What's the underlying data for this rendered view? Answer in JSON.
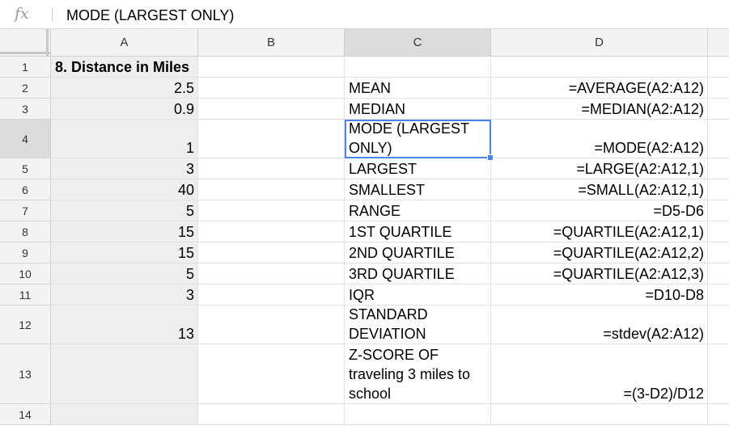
{
  "formula_bar": {
    "fx_icon": "fx",
    "value": "MODE (LARGEST ONLY)"
  },
  "columns": [
    {
      "label": "A",
      "selected": false
    },
    {
      "label": "B",
      "selected": false
    },
    {
      "label": "C",
      "selected": true
    },
    {
      "label": "D",
      "selected": false
    }
  ],
  "rows": [
    {
      "num": "1",
      "a": "8. Distance in Miles",
      "c": "",
      "d": ""
    },
    {
      "num": "2",
      "a": "2.5",
      "c": "MEAN",
      "d": "=AVERAGE(A2:A12)"
    },
    {
      "num": "3",
      "a": "0.9",
      "c": "MEDIAN",
      "d": "=MEDIAN(A2:A12)"
    },
    {
      "num": "4",
      "a": "1",
      "c": "MODE (LARGEST ONLY)",
      "d": "=MODE(A2:A12)"
    },
    {
      "num": "5",
      "a": "3",
      "c": "LARGEST",
      "d": "=LARGE(A2:A12,1)"
    },
    {
      "num": "6",
      "a": "40",
      "c": "SMALLEST",
      "d": "=SMALL(A2:A12,1)"
    },
    {
      "num": "7",
      "a": "5",
      "c": "RANGE",
      "d": "=D5-D6"
    },
    {
      "num": "8",
      "a": "15",
      "c": "1ST QUARTILE",
      "d": "=QUARTILE(A2:A12,1)"
    },
    {
      "num": "9",
      "a": "15",
      "c": "2ND QUARTILE",
      "d": "=QUARTILE(A2:A12,2)"
    },
    {
      "num": "10",
      "a": "5",
      "c": "3RD QUARTILE",
      "d": "=QUARTILE(A2:A12,3)"
    },
    {
      "num": "11",
      "a": "3",
      "c": "IQR",
      "d": "=D10-D8"
    },
    {
      "num": "12",
      "a": "13",
      "c": "STANDARD DEVIATION",
      "d": "=stdev(A2:A12)"
    },
    {
      "num": "13",
      "a": "",
      "c": "Z-SCORE OF traveling 3 miles to school",
      "d": "=(3-D2)/D12"
    },
    {
      "num": "14",
      "a": "",
      "c": "",
      "d": ""
    }
  ],
  "active_cell": "C4",
  "accent_color": "#4a86e8"
}
